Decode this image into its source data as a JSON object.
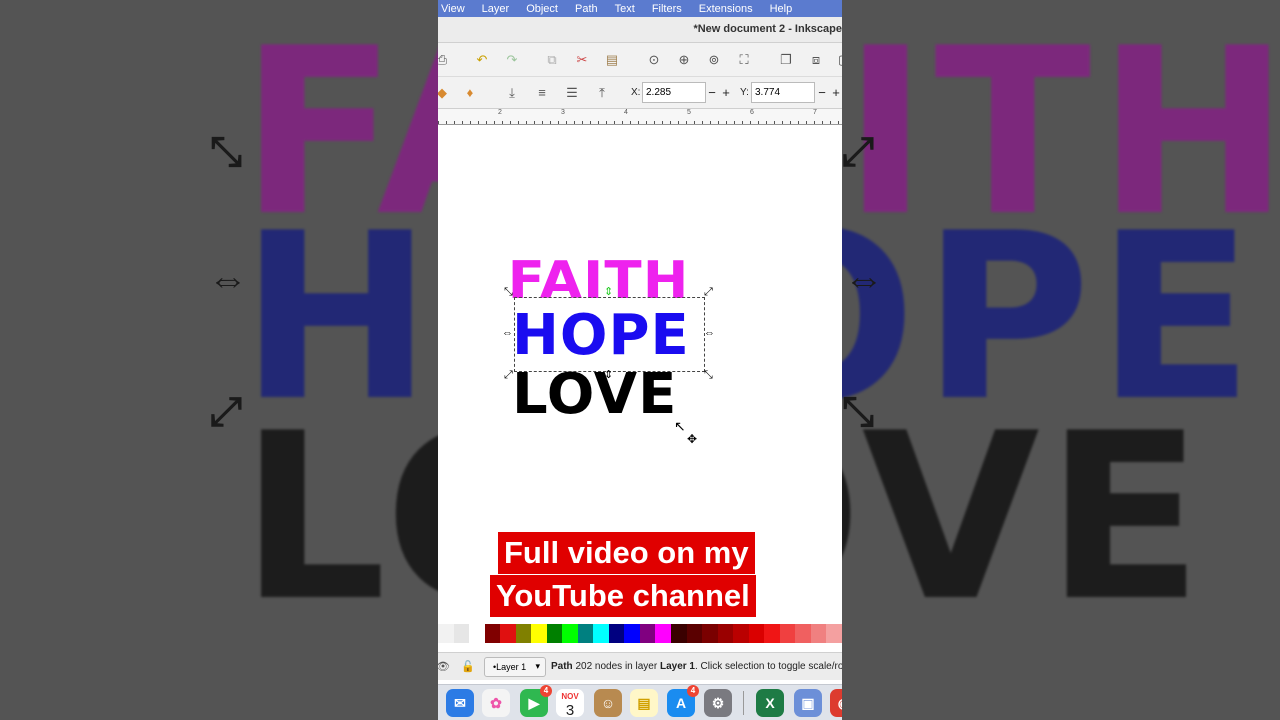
{
  "app": {
    "window_title": "*New document 2 - Inkscape",
    "menu": [
      "View",
      "Layer",
      "Object",
      "Path",
      "Text",
      "Filters",
      "Extensions",
      "Help"
    ]
  },
  "toolbar": {
    "x_label": "X:",
    "x_value": "2.285",
    "y_label": "Y:",
    "y_value": "3.774",
    "minus": "−",
    "plus": "+"
  },
  "ruler": {
    "labels": [
      "2",
      "3",
      "4",
      "5",
      "6",
      "7"
    ]
  },
  "canvas": {
    "words": [
      "FAITH",
      "HOPE",
      "LOVE"
    ],
    "colors": {
      "faith": "#ee22ee",
      "hope": "#1a0cf0",
      "love": "#000000"
    }
  },
  "overlay": {
    "line1": "Full video on my",
    "line2": "YouTube channel"
  },
  "palette": [
    "#f2f2f2",
    "#e6e6e6",
    "#ffffff",
    "#800000",
    "#e01010",
    "#808000",
    "#ffff00",
    "#008000",
    "#00ff00",
    "#008080",
    "#00ffff",
    "#000080",
    "#0000ff",
    "#800080",
    "#ff00ff",
    "#3a0000",
    "#5a0000",
    "#7a0000",
    "#9a0000",
    "#ba0000",
    "#da0000",
    "#f01515",
    "#f04040",
    "#f06060",
    "#f08080",
    "#f4a0a0"
  ],
  "status": {
    "layer": "•Layer 1",
    "message_bold": "Path",
    "message": "202 nodes in layer",
    "layer_bold": "Layer 1",
    "message_tail": ". Click selection to toggle scale/rota"
  },
  "dock": {
    "calendar_month": "NOV",
    "calendar_day": "3",
    "facetime_badge": "4",
    "appstore_badge": "4"
  }
}
